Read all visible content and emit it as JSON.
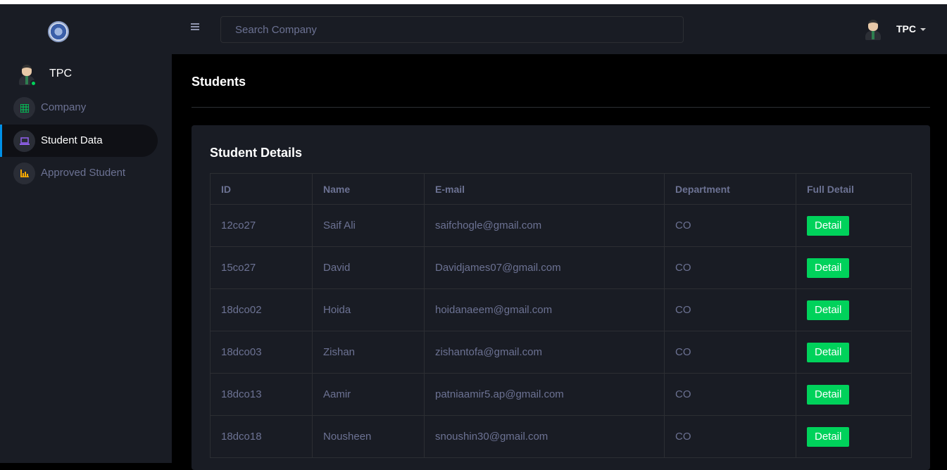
{
  "sidebar": {
    "profile_name": "TPC",
    "items": [
      {
        "label": "Company",
        "icon": "grid-icon",
        "color": "#00d25b"
      },
      {
        "label": "Student Data",
        "icon": "laptop-icon",
        "color": "#8f5fe8"
      },
      {
        "label": "Approved Student",
        "icon": "bar-chart-icon",
        "color": "#ffab00"
      }
    ]
  },
  "topbar": {
    "search_placeholder": "Search Company",
    "user_name": "TPC"
  },
  "main": {
    "page_title": "Students",
    "card_title": "Student Details",
    "table": {
      "headers": [
        "ID",
        "Name",
        "E-mail",
        "Department",
        "Full Detail"
      ],
      "detail_label": "Detail",
      "rows": [
        [
          "12co27",
          "Saif Ali",
          "saifchogle@gmail.com",
          "CO"
        ],
        [
          "15co27",
          "David",
          "Davidjames07@gmail.com",
          "CO"
        ],
        [
          "18dco02",
          "Hoida",
          "hoidanaeem@gmail.com",
          "CO"
        ],
        [
          "18dco03",
          "Zishan",
          "zishantofa@gmail.com",
          "CO"
        ],
        [
          "18dco13",
          "Aamir",
          "patniaamir5.ap@gmail.com",
          "CO"
        ],
        [
          "18dco18",
          "Nousheen",
          "snoushin30@gmail.com",
          "CO"
        ]
      ]
    }
  },
  "colors": {
    "accent_green": "#00d25b",
    "active_blue": "#0090e7",
    "panel": "#191c24"
  }
}
